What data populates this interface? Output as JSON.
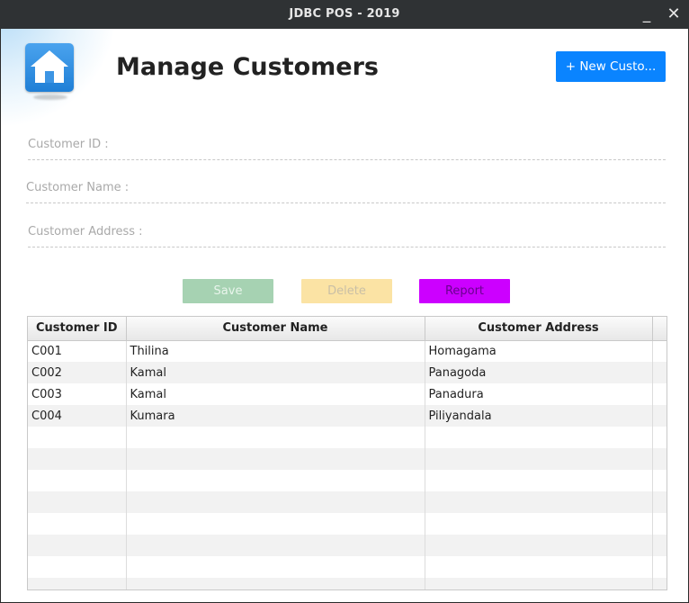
{
  "window": {
    "title": "JDBC POS - 2019",
    "minimize_glyph": "_",
    "close_glyph": "✕"
  },
  "header": {
    "title": "Manage Customers",
    "home_icon": "home-icon",
    "new_button_label": "+ New Custo..."
  },
  "form": {
    "customer_id_placeholder": "Customer ID :",
    "customer_name_placeholder": "Customer Name :",
    "customer_address_placeholder": "Customer Address :"
  },
  "actions": {
    "save_label": "Save",
    "delete_label": "Delete",
    "report_label": "Report"
  },
  "table": {
    "columns": [
      "Customer ID",
      "Customer Name",
      "Customer Address"
    ],
    "rows": [
      [
        "C001",
        "Thilina",
        "Homagama"
      ],
      [
        "C002",
        "Kamal",
        "Panagoda"
      ],
      [
        "C003",
        "Kamal",
        "Panadura"
      ],
      [
        "C004",
        "Kumara",
        "Piliyandala"
      ],
      [
        "",
        "",
        ""
      ],
      [
        "",
        "",
        ""
      ],
      [
        "",
        "",
        ""
      ],
      [
        "",
        "",
        ""
      ],
      [
        "",
        "",
        ""
      ],
      [
        "",
        "",
        ""
      ],
      [
        "",
        "",
        ""
      ],
      [
        "",
        "",
        ""
      ]
    ]
  },
  "colors": {
    "new_button": "#0a84ff",
    "save_button": "#a6d2b2",
    "delete_button": "#fbe3a4",
    "report_button": "#cc00ff",
    "titlebar": "#2f3234"
  }
}
